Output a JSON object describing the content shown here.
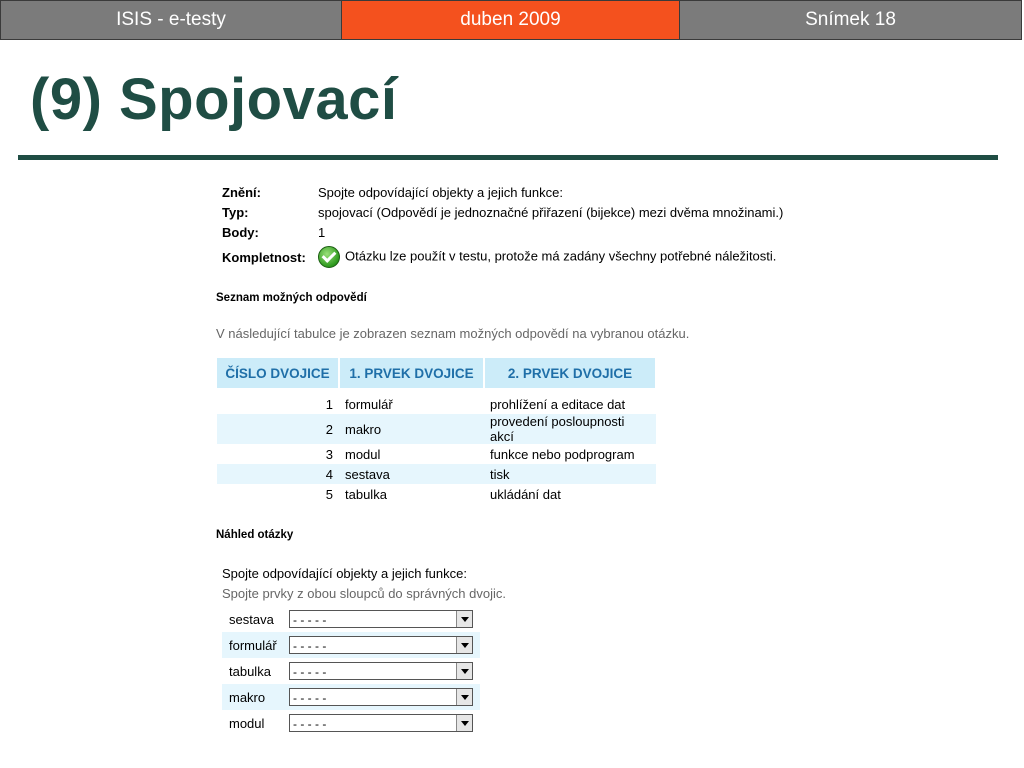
{
  "header": {
    "left": "ISIS - e-testy",
    "center": "duben 2009",
    "right": "Snímek 18"
  },
  "title": "(9) Spojovací",
  "info": {
    "zneni_label": "Znění:",
    "zneni_value": "Spojte odpovídající objekty a jejich funkce:",
    "typ_label": "Typ:",
    "typ_value": "spojovací (Odpovědí je jednoznačné přiřazení (bijekce) mezi dvěma množinami.)",
    "body_label": "Body:",
    "body_value": "1",
    "kompletnost_label": "Kompletnost:",
    "kompletnost_value": "Otázku lze použít v testu, protože má zadány všechny potřebné náležitosti."
  },
  "answers": {
    "heading": "Seznam možných odpovědí",
    "description": "V následující tabulce je zobrazen seznam možných odpovědí na vybranou otázku.",
    "columns": [
      "ČÍSLO DVOJICE",
      "1. PRVEK DVOJICE",
      "2. PRVEK DVOJICE"
    ],
    "rows": [
      {
        "num": "1",
        "first": "formulář",
        "second": "prohlížení a editace dat"
      },
      {
        "num": "2",
        "first": "makro",
        "second": "provedení posloupnosti akcí"
      },
      {
        "num": "3",
        "first": "modul",
        "second": "funkce nebo podprogram"
      },
      {
        "num": "4",
        "first": "sestava",
        "second": "tisk"
      },
      {
        "num": "5",
        "first": "tabulka",
        "second": "ukládání dat"
      }
    ]
  },
  "preview": {
    "heading": "Náhled otázky",
    "question": "Spojte odpovídající objekty a jejich funkce:",
    "hint": "Spojte prvky z obou sloupců do správných dvojic.",
    "items": [
      {
        "label": "sestava",
        "selected": "- - - - -"
      },
      {
        "label": "formulář",
        "selected": "- - - - -"
      },
      {
        "label": "tabulka",
        "selected": "- - - - -"
      },
      {
        "label": "makro",
        "selected": "- - - - -"
      },
      {
        "label": "modul",
        "selected": "- - - - -"
      }
    ]
  },
  "colors": {
    "header_gray": "#7b7b7b",
    "header_accent": "#f4511e",
    "title": "#1f4d44",
    "table_header_bg": "#ccecf9",
    "table_header_text": "#1f6fa8",
    "row_alt": "#e6f6fd"
  },
  "icons": {
    "kompletnost": "check-circle-icon",
    "select_arrow": "chevron-down-icon"
  }
}
